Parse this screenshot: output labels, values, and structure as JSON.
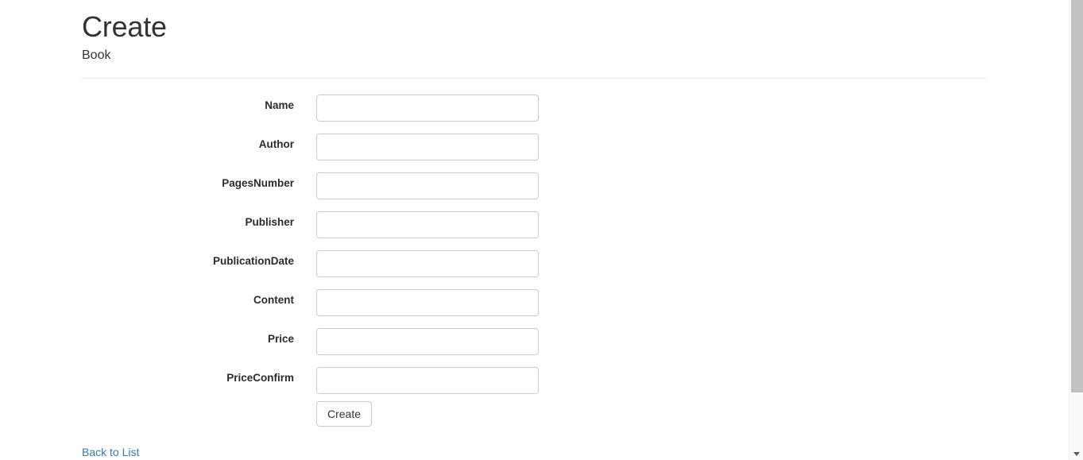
{
  "page": {
    "title": "Create",
    "subtitle": "Book"
  },
  "form": {
    "fields": [
      {
        "label": "Name",
        "value": "",
        "placeholder": ""
      },
      {
        "label": "Author",
        "value": "",
        "placeholder": ""
      },
      {
        "label": "PagesNumber",
        "value": "",
        "placeholder": ""
      },
      {
        "label": "Publisher",
        "value": "",
        "placeholder": ""
      },
      {
        "label": "PublicationDate",
        "value": "",
        "placeholder": ""
      },
      {
        "label": "Content",
        "value": "",
        "placeholder": ""
      },
      {
        "label": "Price",
        "value": "",
        "placeholder": ""
      },
      {
        "label": "PriceConfirm",
        "value": "",
        "placeholder": ""
      }
    ],
    "submit_label": "Create"
  },
  "navigation": {
    "back_link_label": "Back to List"
  },
  "icons": {
    "scroll_down": "chevron-down-icon"
  },
  "colors": {
    "link": "#337ab7",
    "text": "#333333",
    "label": "#2b2b2b",
    "input_border": "#cccccc",
    "divider": "#eeeeee",
    "scrollbar_thumb": "#c1c1c1",
    "background": "#ffffff"
  }
}
